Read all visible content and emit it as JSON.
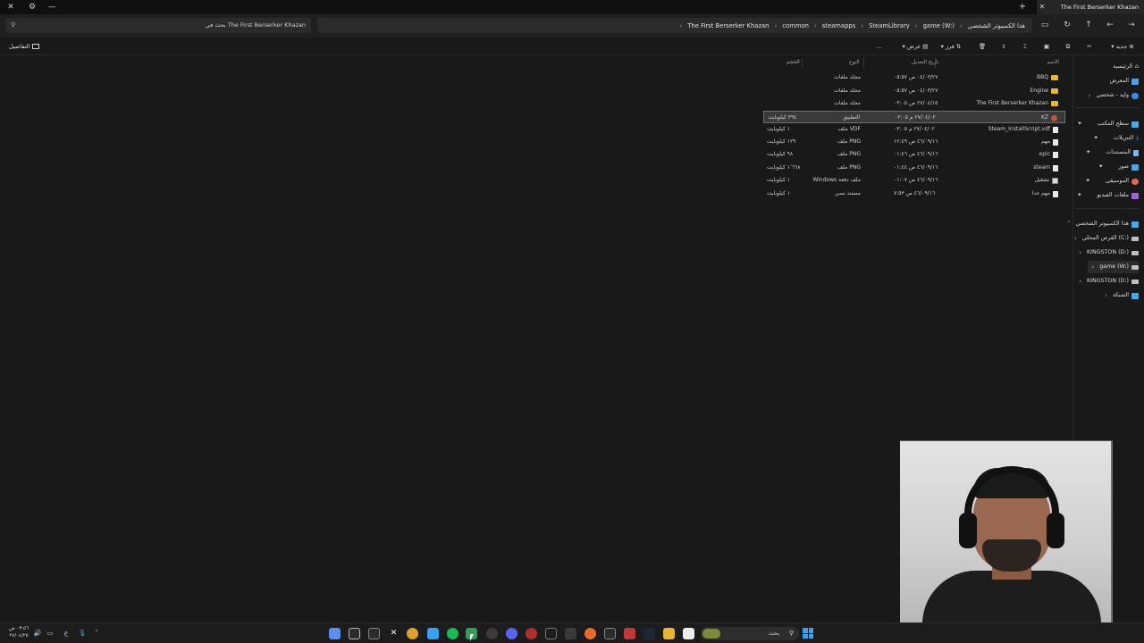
{
  "window": {
    "tab_title": "The First Berserker Khazan",
    "close_glyph": "✕",
    "add_glyph": "+",
    "ctrl_close": "✕",
    "ctrl_settings": "⚙",
    "ctrl_min": "—"
  },
  "address": {
    "search_placeholder": "بحث في The First Berserker Khazan",
    "breadcrumbs": [
      "هذا الكمبيوتر الشخصي",
      "game (W:)",
      "SteamLibrary",
      "steamapps",
      "common",
      "The First Berserker Khazan"
    ]
  },
  "commandbar": {
    "new_label": "جديد",
    "sort_label": "فرز",
    "view_label": "عرض",
    "more_label": "...",
    "details_label": "التفاصيل"
  },
  "columns": {
    "name": "الاسم",
    "date": "تاريخ التعديل",
    "type": "النوع",
    "size": "الحجم"
  },
  "files": [
    {
      "name": "BBQ",
      "date": "٠٤/٠٣/٢٧ ص ٠٥:٥٧",
      "type": "مجلد ملفات",
      "size": "",
      "icon": "folder"
    },
    {
      "name": "Engine",
      "date": "٠٤/٠٣/٢٧ ص ٠٥:٥٧",
      "type": "مجلد ملفات",
      "size": "",
      "icon": "folder"
    },
    {
      "name": "The First Berserker Khazan",
      "date": "٢٧/٠٤/١٥ ص ٠٣:٠٥",
      "type": "مجلد ملفات",
      "size": "",
      "icon": "folder"
    },
    {
      "name": "KZ",
      "date": "٢٧/٠٤/٠٢ م ٠٣:٠٥",
      "type": "التطبيق",
      "size": "٣٩٤ كيلوبايت",
      "icon": "app"
    },
    {
      "name": "Steam_InstallScript.vdf",
      "date": "٢٧/٠٤/٠٢ م ٠٣:٠٥",
      "type": "ملف VDF",
      "size": "١ كيلوبايت",
      "icon": "file"
    },
    {
      "name": "مهم",
      "date": "٤٦/٠٩/١٦ ص ١٢:٤٩",
      "type": "ملف PNG",
      "size": "١٢٩ كيلوبايت",
      "icon": "file"
    },
    {
      "name": "epic",
      "date": "٤٦/٠٩/١٦ ص ٠١:٤٦",
      "type": "ملف PNG",
      "size": "٩٨ كيلوبايت",
      "icon": "file"
    },
    {
      "name": "steam",
      "date": "٤٦/٠٩/١٦ ص ٠١:٤٤",
      "type": "ملف PNG",
      "size": "١٬٦٦٨ كيلوبايت",
      "icon": "file"
    },
    {
      "name": "تشغيل",
      "date": "٤٦/٠٩/١٦ ص ٠١:٠٧",
      "type": "Windows ملف دفعة",
      "size": "١ كيلوبايت",
      "icon": "img"
    },
    {
      "name": "مهم جدا",
      "date": "٤٦/٠٩/١٦ ص ٧:٥٣",
      "type": "مستند نصي",
      "size": "١ كيلوبايت",
      "icon": "file"
    }
  ],
  "sidebar": {
    "items": [
      {
        "label": "الرئيسية",
        "color": "#d9d9d9"
      },
      {
        "label": "المعرض",
        "color": "#4fa3e0"
      },
      {
        "label": "وليد - شخصي",
        "color": "#3a8ee0"
      },
      {
        "label": "سطح المكتب",
        "color": "#4aa8e8"
      },
      {
        "label": "التنزيلات",
        "color": "#52b0e0"
      },
      {
        "label": "المستندات",
        "color": "#7fb4e0"
      },
      {
        "label": "صور",
        "color": "#4fa3e0"
      },
      {
        "label": "الموسيقى",
        "color": "#e06a5a"
      },
      {
        "label": "ملفات الفيديو",
        "color": "#9a66d0"
      },
      {
        "label": "هذا الكمبيوتر الشخصي",
        "color": "#4aa8e8"
      },
      {
        "label": "القرص المحلي (C:)",
        "color": "#bfbfbf"
      },
      {
        "label": "KINGSTON (D:)",
        "color": "#bfbfbf"
      },
      {
        "label": "game (W:)",
        "color": "#bfbfbf"
      },
      {
        "label": "KINGSTON (D:)",
        "color": "#bfbfbf"
      },
      {
        "label": "الشبكة",
        "color": "#4aa8e8"
      }
    ]
  },
  "taskbar": {
    "time": "٠٣:٥٦ ص",
    "date": "٢٧/٠٤/٢٥",
    "lang": "ع",
    "search_placeholder": "بحث"
  }
}
